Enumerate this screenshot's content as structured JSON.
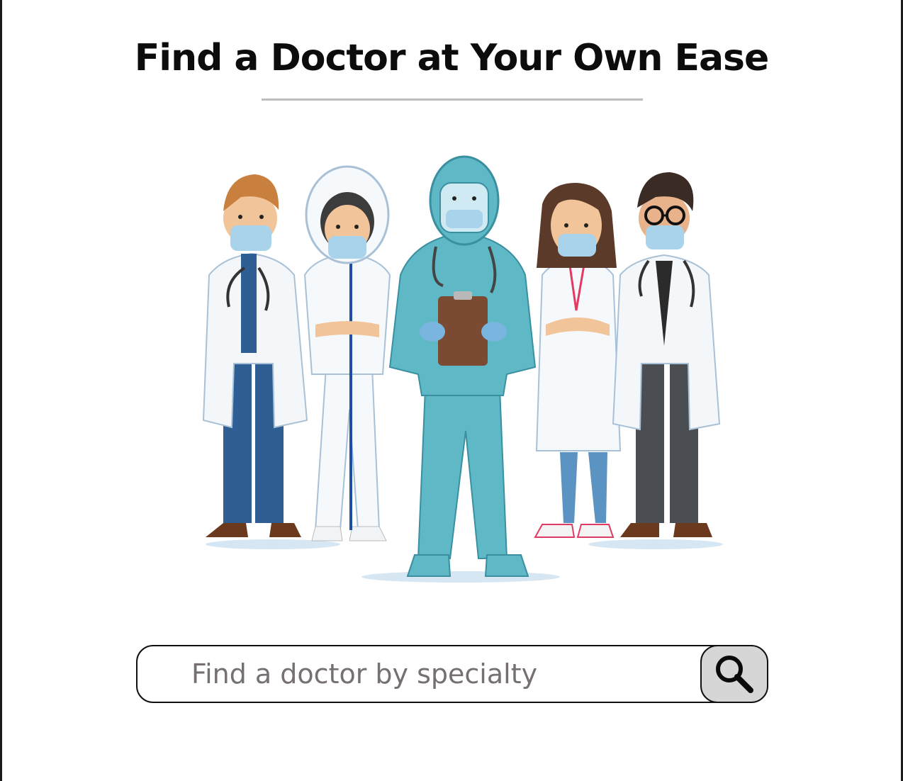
{
  "header": {
    "title": "Find a Doctor at Your Own Ease"
  },
  "illustration": {
    "subject": "team of five medical workers in coats and protective suits"
  },
  "search": {
    "placeholder": "Find a doctor by specialty",
    "value": "",
    "button_icon": "search-icon"
  },
  "colors": {
    "accent_bg": "#d6d6d6",
    "border": "#111111",
    "placeholder": "#767070",
    "divider": "#bdbdbd"
  }
}
